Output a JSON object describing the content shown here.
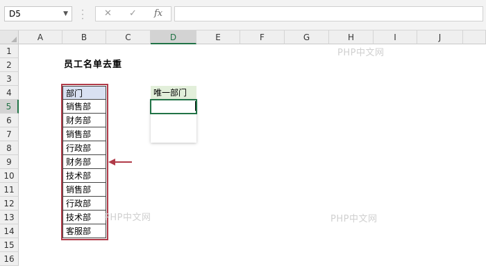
{
  "formula_bar": {
    "name_box": "D5",
    "cancel_symbol": "✕",
    "enter_symbol": "✓",
    "fx_symbol": "fx",
    "formula": ""
  },
  "columns": [
    "A",
    "B",
    "C",
    "D",
    "E",
    "F",
    "G",
    "H",
    "I",
    "J"
  ],
  "selected_column": "D",
  "rows": [
    "1",
    "2",
    "3",
    "4",
    "5",
    "6",
    "7",
    "8",
    "9",
    "10",
    "11",
    "12",
    "13",
    "14",
    "15",
    "16"
  ],
  "selected_row": "5",
  "sheet": {
    "title": "员工名单去重",
    "dept_header": "部门",
    "departments": [
      "销售部",
      "财务部",
      "销售部",
      "行政部",
      "财务部",
      "技术部",
      "销售部",
      "行政部",
      "技术部",
      "客服部"
    ],
    "unique_header": "唯一部门",
    "active_cell_value": ""
  },
  "highlight_color": "#b03a48",
  "accent_color": "#217346",
  "watermark": "PHP中文网"
}
